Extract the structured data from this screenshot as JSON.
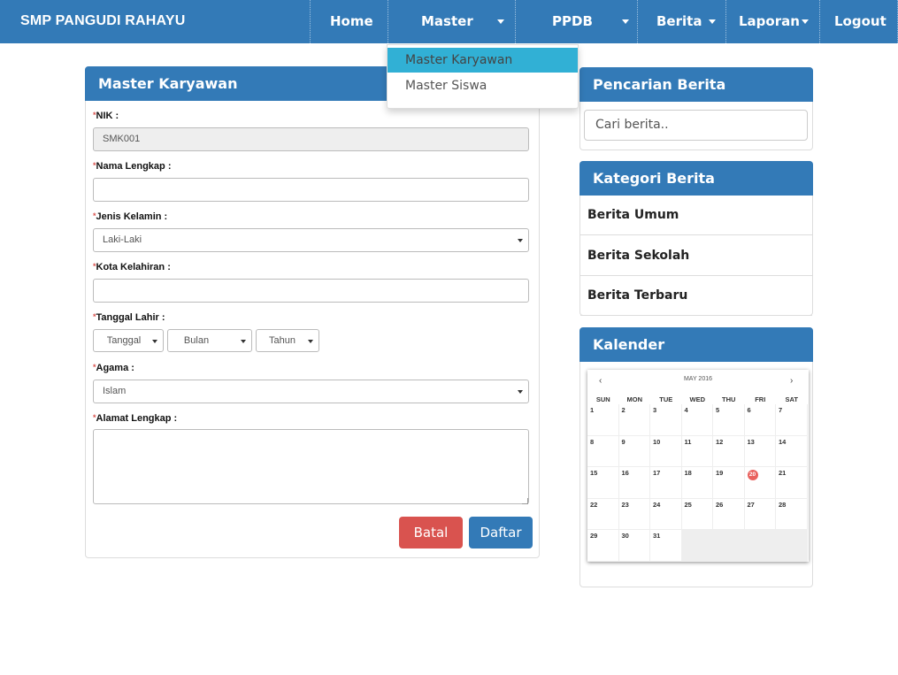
{
  "navbar": {
    "brand": "SMP PANGUDI RAHAYU",
    "items": [
      {
        "label": "Home"
      },
      {
        "label": "Master"
      },
      {
        "label": "PPDB"
      },
      {
        "label": "Berita"
      },
      {
        "label": "Laporan"
      },
      {
        "label": "Logout"
      }
    ]
  },
  "dropdown": {
    "items": [
      {
        "label": "Master Karyawan"
      },
      {
        "label": "Master Siswa"
      }
    ]
  },
  "form": {
    "title": "Master Karyawan",
    "required_mark": "*",
    "nik_label": "NIK :",
    "nik_value": "SMK001",
    "nama_label": "Nama Lengkap :",
    "nama_value": "",
    "jk_label": "Jenis Kelamin :",
    "jk_value": "Laki-Laki",
    "kota_label": "Kota Kelahiran :",
    "kota_value": "",
    "tgl_label": "Tanggal Lahir :",
    "tgl_day": "Tanggal",
    "tgl_month": "Bulan",
    "tgl_year": "Tahun",
    "agama_label": "Agama :",
    "agama_value": "Islam",
    "alamat_label": "Alamat Lengkap :",
    "alamat_value": "",
    "batal_label": "Batal",
    "daftar_label": "Daftar"
  },
  "sidebar": {
    "search_title": "Pencarian Berita",
    "search_placeholder": "Cari berita..",
    "category_title": "Kategori Berita",
    "categories": [
      {
        "label": "Berita Umum"
      },
      {
        "label": "Berita Sekolah"
      },
      {
        "label": "Berita Terbaru"
      }
    ],
    "calendar_title": "Kalender"
  },
  "calendar": {
    "month_label": "MAY 2016",
    "prev": "‹",
    "next": "›",
    "dow": [
      "SUN",
      "MON",
      "TUE",
      "WED",
      "THU",
      "FRI",
      "SAT"
    ],
    "weeks": [
      [
        "1",
        "2",
        "3",
        "4",
        "5",
        "6",
        "7"
      ],
      [
        "8",
        "9",
        "10",
        "11",
        "12",
        "13",
        "14"
      ],
      [
        "15",
        "16",
        "17",
        "18",
        "19",
        "20",
        "21"
      ],
      [
        "22",
        "23",
        "24",
        "25",
        "26",
        "27",
        "28"
      ],
      [
        "29",
        "30",
        "31",
        "",
        "",
        "",
        ""
      ]
    ],
    "today": "20",
    "colors": {
      "today": "#e9625e",
      "header": "#337ab7",
      "batal": "#d9534f",
      "dropdown_active": "#31b0d5"
    }
  }
}
